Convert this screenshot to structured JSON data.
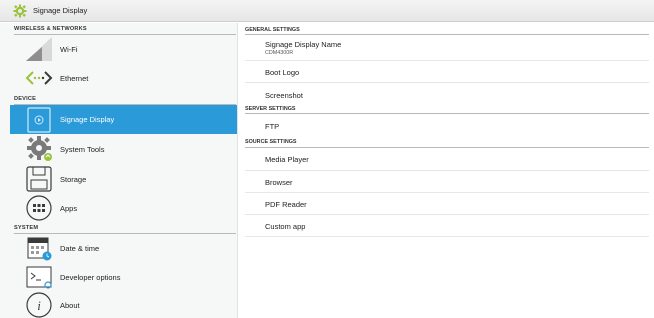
{
  "window": {
    "title": "Signage Display"
  },
  "sidebar": {
    "sections": [
      {
        "label": "WIRELESS & NETWORKS"
      },
      {
        "label": "DEVICE"
      },
      {
        "label": "SYSTEM"
      }
    ],
    "items": [
      {
        "label": "Wi-Fi",
        "icon": "wifi-icon"
      },
      {
        "label": "Ethernet",
        "icon": "ethernet-icon"
      },
      {
        "label": "Signage Display",
        "icon": "signage-display-icon",
        "selected": true
      },
      {
        "label": "System Tools",
        "icon": "gear-icon"
      },
      {
        "label": "Storage",
        "icon": "storage-icon"
      },
      {
        "label": "Apps",
        "icon": "apps-icon"
      },
      {
        "label": "Date & time",
        "icon": "calendar-icon"
      },
      {
        "label": "Developer options",
        "icon": "terminal-icon"
      },
      {
        "label": "About",
        "icon": "info-icon"
      }
    ]
  },
  "content": {
    "sections": [
      {
        "label": "GENERAL SETTINGS"
      },
      {
        "label": "SERVER SETTINGS"
      },
      {
        "label": "SOURCE SETTINGS"
      }
    ],
    "items": [
      {
        "title": "Signage Display Name",
        "subtitle": "CDM4300R"
      },
      {
        "title": "Boot Logo"
      },
      {
        "title": "Screenshot"
      },
      {
        "title": "FTP"
      },
      {
        "title": "Media Player"
      },
      {
        "title": "Browser"
      },
      {
        "title": "PDF Reader"
      },
      {
        "title": "Custom app"
      }
    ]
  },
  "colors": {
    "accent": "#2a9bd8",
    "sidebar_bg": "#f6f7f7"
  }
}
